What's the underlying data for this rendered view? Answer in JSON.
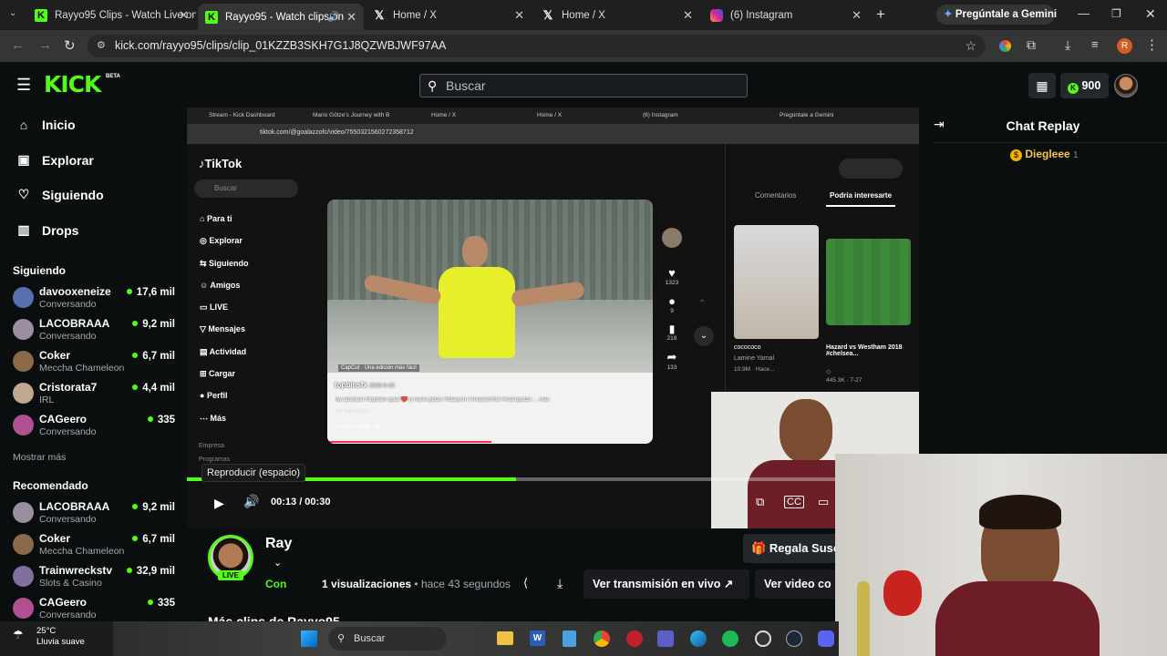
{
  "browser": {
    "tabs": [
      {
        "label": "Rayyo95 Clips - Watch Live on",
        "active": false
      },
      {
        "label": "Rayyo95 - Watch clips on",
        "active": true
      },
      {
        "label": "Home / X",
        "active": false
      },
      {
        "label": "Home / X",
        "active": false
      },
      {
        "label": "(6) Instagram",
        "active": false
      }
    ],
    "gemini_label": "Pregúntale a Gemini",
    "url": "kick.com/rayyo95/clips/clip_01KZZB3SKH7G1J8QZWBJWF97AA",
    "profile_initial": "R"
  },
  "kick": {
    "logo_text": "KICK",
    "beta": "BETA",
    "search_placeholder": "Buscar",
    "balance": "900",
    "nav": [
      {
        "label": "Inicio",
        "icon": "home-icon"
      },
      {
        "label": "Explorar",
        "icon": "browse-icon"
      },
      {
        "label": "Siguiendo",
        "icon": "heart-icon"
      },
      {
        "label": "Drops",
        "icon": "drops-icon"
      }
    ],
    "following_title": "Siguiendo",
    "following": [
      {
        "name": "davooxeneize",
        "sub": "Conversando",
        "viewers": "17,6 mil",
        "color": "#5a6fb0"
      },
      {
        "name": "LACOBRAAA",
        "sub": "Conversando",
        "viewers": "9,2 mil",
        "color": "#9a8fa0"
      },
      {
        "name": "Coker",
        "sub": "Meccha Chameleon",
        "viewers": "6,7 mil",
        "color": "#8a6a4a"
      },
      {
        "name": "Cristorata7",
        "sub": "IRL",
        "viewers": "4,4 mil",
        "color": "#c0a890"
      },
      {
        "name": "CAGeero",
        "sub": "Conversando",
        "viewers": "335",
        "color": "#b05090"
      }
    ],
    "show_more": "Mostrar más",
    "recommended_title": "Recomendado",
    "recommended": [
      {
        "name": "LACOBRAAA",
        "sub": "Conversando",
        "viewers": "9,2 mil",
        "color": "#9a8fa0"
      },
      {
        "name": "Coker",
        "sub": "Meccha Chameleon",
        "viewers": "6,7 mil",
        "color": "#8a6a4a"
      },
      {
        "name": "Trainwreckstv",
        "sub": "Slots & Casino",
        "viewers": "32,9 mil",
        "color": "#8070a0"
      },
      {
        "name": "CAGeero",
        "sub": "Conversando",
        "viewers": "335",
        "color": "#b05090"
      }
    ],
    "player": {
      "tooltip": "Reproducir (espacio)",
      "time": "00:13 / 00:30",
      "progress": 0.45
    },
    "clip": {
      "channel": "Ray",
      "live": "LIVE",
      "conv": "Con",
      "views_count": "1",
      "views_label": "visualizaciones",
      "ago": "• hace 43 segundos",
      "watch_live": "Ver transmisión en vivo",
      "watch_video": "Ver video co",
      "gift_sub": "Regala Susc",
      "more_clips": "Más clips de Rayyo95"
    },
    "chat": {
      "title": "Chat Replay",
      "user": "Diegleee",
      "badge_count": "1"
    }
  },
  "inner": {
    "tabs": [
      "Stream - Kick Dashboard",
      "Mario Götze's Journey with B",
      "Home / X",
      "Home / X",
      "(6) Instagram"
    ],
    "gemini": "Pregúntale a Gemini",
    "url": "tiktok.com/@goalazzofc/video/7550321560272358712",
    "tiktok_logo": "TikTok",
    "search": "Buscar",
    "nav": [
      "Para ti",
      "Explorar",
      "Siguiendo",
      "Amigos",
      "LIVE",
      "Mensajes",
      "Actividad",
      "Cargar",
      "Perfil",
      "Más"
    ],
    "footer": [
      "Empresa",
      "Programas"
    ],
    "capcut": "CapCut · Una edición más fácil",
    "author": "topbinsfx",
    "date": "2025-9-15",
    "caption": "my absolute forgotten goat ❤️ || mario götze #fcbayern #milasanmia #mariogotze ...",
    "more": "más",
    "translate": "Ver traducción",
    "sound": "♫ som original - th",
    "likes": "1323",
    "comments": "9",
    "saves": "219",
    "shares": "133",
    "right_tabs": [
      "Comentarios",
      "Podría interesarte"
    ],
    "cards": [
      {
        "title": "cocococo",
        "sub": "Lamine Yamal",
        "views": "10.9M · Hace..."
      },
      {
        "title": "Hazard vs Westham 2018 #chelsea...",
        "sub": "◇",
        "views": "445.3K · 7-27"
      }
    ]
  },
  "taskbar": {
    "temp": "25°C",
    "weather": "Lluvia suave",
    "search": "Buscar"
  },
  "colors": {
    "kick_green": "#53fc18",
    "bg": "#0b0e0f"
  }
}
